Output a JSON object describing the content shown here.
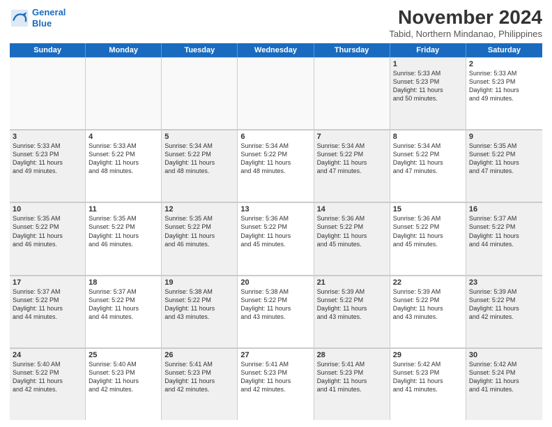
{
  "header": {
    "logo_line1": "General",
    "logo_line2": "Blue",
    "month_year": "November 2024",
    "location": "Tabid, Northern Mindanao, Philippines"
  },
  "weekdays": [
    "Sunday",
    "Monday",
    "Tuesday",
    "Wednesday",
    "Thursday",
    "Friday",
    "Saturday"
  ],
  "rows": [
    [
      {
        "day": "",
        "detail": "",
        "empty": true
      },
      {
        "day": "",
        "detail": "",
        "empty": true
      },
      {
        "day": "",
        "detail": "",
        "empty": true
      },
      {
        "day": "",
        "detail": "",
        "empty": true
      },
      {
        "day": "",
        "detail": "",
        "empty": true
      },
      {
        "day": "1",
        "detail": "Sunrise: 5:33 AM\nSunset: 5:23 PM\nDaylight: 11 hours\nand 50 minutes.",
        "shaded": true
      },
      {
        "day": "2",
        "detail": "Sunrise: 5:33 AM\nSunset: 5:23 PM\nDaylight: 11 hours\nand 49 minutes.",
        "shaded": false
      }
    ],
    [
      {
        "day": "3",
        "detail": "Sunrise: 5:33 AM\nSunset: 5:23 PM\nDaylight: 11 hours\nand 49 minutes.",
        "shaded": true
      },
      {
        "day": "4",
        "detail": "Sunrise: 5:33 AM\nSunset: 5:22 PM\nDaylight: 11 hours\nand 48 minutes.",
        "shaded": false
      },
      {
        "day": "5",
        "detail": "Sunrise: 5:34 AM\nSunset: 5:22 PM\nDaylight: 11 hours\nand 48 minutes.",
        "shaded": true
      },
      {
        "day": "6",
        "detail": "Sunrise: 5:34 AM\nSunset: 5:22 PM\nDaylight: 11 hours\nand 48 minutes.",
        "shaded": false
      },
      {
        "day": "7",
        "detail": "Sunrise: 5:34 AM\nSunset: 5:22 PM\nDaylight: 11 hours\nand 47 minutes.",
        "shaded": true
      },
      {
        "day": "8",
        "detail": "Sunrise: 5:34 AM\nSunset: 5:22 PM\nDaylight: 11 hours\nand 47 minutes.",
        "shaded": false
      },
      {
        "day": "9",
        "detail": "Sunrise: 5:35 AM\nSunset: 5:22 PM\nDaylight: 11 hours\nand 47 minutes.",
        "shaded": true
      }
    ],
    [
      {
        "day": "10",
        "detail": "Sunrise: 5:35 AM\nSunset: 5:22 PM\nDaylight: 11 hours\nand 46 minutes.",
        "shaded": true
      },
      {
        "day": "11",
        "detail": "Sunrise: 5:35 AM\nSunset: 5:22 PM\nDaylight: 11 hours\nand 46 minutes.",
        "shaded": false
      },
      {
        "day": "12",
        "detail": "Sunrise: 5:35 AM\nSunset: 5:22 PM\nDaylight: 11 hours\nand 46 minutes.",
        "shaded": true
      },
      {
        "day": "13",
        "detail": "Sunrise: 5:36 AM\nSunset: 5:22 PM\nDaylight: 11 hours\nand 45 minutes.",
        "shaded": false
      },
      {
        "day": "14",
        "detail": "Sunrise: 5:36 AM\nSunset: 5:22 PM\nDaylight: 11 hours\nand 45 minutes.",
        "shaded": true
      },
      {
        "day": "15",
        "detail": "Sunrise: 5:36 AM\nSunset: 5:22 PM\nDaylight: 11 hours\nand 45 minutes.",
        "shaded": false
      },
      {
        "day": "16",
        "detail": "Sunrise: 5:37 AM\nSunset: 5:22 PM\nDaylight: 11 hours\nand 44 minutes.",
        "shaded": true
      }
    ],
    [
      {
        "day": "17",
        "detail": "Sunrise: 5:37 AM\nSunset: 5:22 PM\nDaylight: 11 hours\nand 44 minutes.",
        "shaded": true
      },
      {
        "day": "18",
        "detail": "Sunrise: 5:37 AM\nSunset: 5:22 PM\nDaylight: 11 hours\nand 44 minutes.",
        "shaded": false
      },
      {
        "day": "19",
        "detail": "Sunrise: 5:38 AM\nSunset: 5:22 PM\nDaylight: 11 hours\nand 43 minutes.",
        "shaded": true
      },
      {
        "day": "20",
        "detail": "Sunrise: 5:38 AM\nSunset: 5:22 PM\nDaylight: 11 hours\nand 43 minutes.",
        "shaded": false
      },
      {
        "day": "21",
        "detail": "Sunrise: 5:39 AM\nSunset: 5:22 PM\nDaylight: 11 hours\nand 43 minutes.",
        "shaded": true
      },
      {
        "day": "22",
        "detail": "Sunrise: 5:39 AM\nSunset: 5:22 PM\nDaylight: 11 hours\nand 43 minutes.",
        "shaded": false
      },
      {
        "day": "23",
        "detail": "Sunrise: 5:39 AM\nSunset: 5:22 PM\nDaylight: 11 hours\nand 42 minutes.",
        "shaded": true
      }
    ],
    [
      {
        "day": "24",
        "detail": "Sunrise: 5:40 AM\nSunset: 5:22 PM\nDaylight: 11 hours\nand 42 minutes.",
        "shaded": true
      },
      {
        "day": "25",
        "detail": "Sunrise: 5:40 AM\nSunset: 5:23 PM\nDaylight: 11 hours\nand 42 minutes.",
        "shaded": false
      },
      {
        "day": "26",
        "detail": "Sunrise: 5:41 AM\nSunset: 5:23 PM\nDaylight: 11 hours\nand 42 minutes.",
        "shaded": true
      },
      {
        "day": "27",
        "detail": "Sunrise: 5:41 AM\nSunset: 5:23 PM\nDaylight: 11 hours\nand 42 minutes.",
        "shaded": false
      },
      {
        "day": "28",
        "detail": "Sunrise: 5:41 AM\nSunset: 5:23 PM\nDaylight: 11 hours\nand 41 minutes.",
        "shaded": true
      },
      {
        "day": "29",
        "detail": "Sunrise: 5:42 AM\nSunset: 5:23 PM\nDaylight: 11 hours\nand 41 minutes.",
        "shaded": false
      },
      {
        "day": "30",
        "detail": "Sunrise: 5:42 AM\nSunset: 5:24 PM\nDaylight: 11 hours\nand 41 minutes.",
        "shaded": true
      }
    ]
  ]
}
